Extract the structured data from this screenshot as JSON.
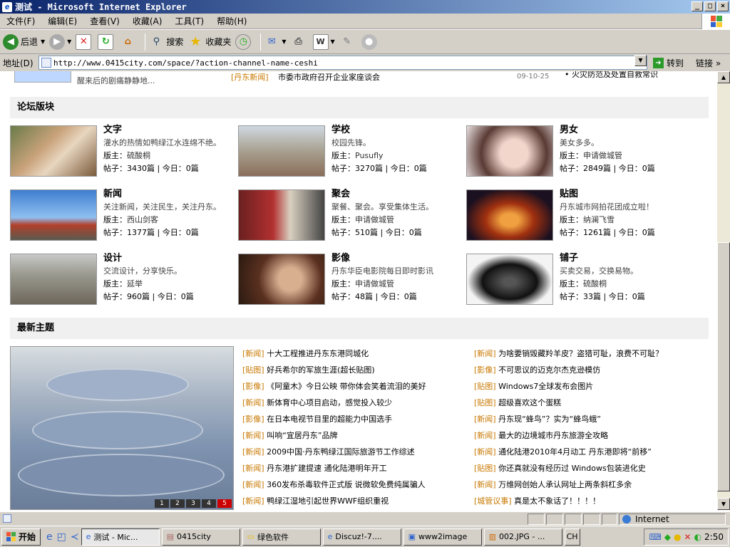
{
  "window": {
    "title": "测试 - Microsoft Internet Explorer",
    "buttons": [
      "_",
      "□",
      "×"
    ]
  },
  "menu": [
    "文件(F)",
    "编辑(E)",
    "查看(V)",
    "收藏(A)",
    "工具(T)",
    "帮助(H)"
  ],
  "toolbar": {
    "back": "后退",
    "search": "搜索",
    "favorites": "收藏夹"
  },
  "address": {
    "label": "地址(D)",
    "url": "http://www.0415city.com/space/?action-channel-name-ceshi",
    "go": "转到",
    "links": "链接"
  },
  "top_partial": {
    "left_text": "醒来后的剧痛静静地...",
    "tag": "[丹东新闻]",
    "title": "市委市政府召开企业家座谈会",
    "date": "09-10-25",
    "right_text": "• 火灾防范及处置自救常识"
  },
  "forums_section": {
    "title": "论坛版块"
  },
  "forums": [
    {
      "name": "文字",
      "desc": "灌水的热情如鸭绿江水连绵不绝。",
      "mod_label": "版主：",
      "mod": "硫酸桐",
      "stats": "帖子：3430篇 | 今日：0篇"
    },
    {
      "name": "学校",
      "desc": "校园先锋。",
      "mod_label": "版主：",
      "mod": "Pusufly",
      "stats": "帖子：3270篇 | 今日：0篇"
    },
    {
      "name": "男女",
      "desc": "美女多多。",
      "mod_label": "版主：",
      "mod": "申请做城管",
      "stats": "帖子：2849篇 | 今日：0篇"
    },
    {
      "name": "新闻",
      "desc": "关注新闻，关注民生，关注丹东。",
      "mod_label": "版主：",
      "mod": "西山剑客",
      "stats": "帖子：1377篇 | 今日：0篇"
    },
    {
      "name": "聚会",
      "desc": "聚餐、聚会。享受集体生活。",
      "mod_label": "版主：",
      "mod": "申请做城管",
      "stats": "帖子：510篇 | 今日：0篇"
    },
    {
      "name": "贴图",
      "desc": "丹东城市网拍花团成立啦！",
      "mod_label": "版主：",
      "mod": "纳澜飞雪",
      "stats": "帖子：1261篇 | 今日：0篇"
    },
    {
      "name": "设计",
      "desc": "交流设计，分享快乐。",
      "mod_label": "版主：",
      "mod": "延举",
      "stats": "帖子：960篇 | 今日：0篇"
    },
    {
      "name": "影像",
      "desc": "丹东华臣电影院每日即时影讯",
      "mod_label": "版主：",
      "mod": "申请做城管",
      "stats": "帖子：48篇 | 今日：0篇"
    },
    {
      "name": "铺子",
      "desc": "买卖交易，交换易物。",
      "mod_label": "版主：",
      "mod": "硫酸桐",
      "stats": "帖子：33篇 | 今日：0篇"
    }
  ],
  "latest_section": {
    "title": "最新主题"
  },
  "slide_pager": [
    "1",
    "2",
    "3",
    "4",
    "5"
  ],
  "topics_left": [
    {
      "tag": "[新闻]",
      "title": "十大工程推进丹东东港同城化"
    },
    {
      "tag": "[贴图]",
      "title": "好兵希尔的军旅生涯(超长贴图)"
    },
    {
      "tag": "[影像]",
      "title": "《阿童木》今日公映 带你体会笑着流泪的美好"
    },
    {
      "tag": "[新闻]",
      "title": "新体育中心项目启动，感觉投入较少"
    },
    {
      "tag": "[影像]",
      "title": "在日本电视节目里的超能力中国选手"
    },
    {
      "tag": "[新闻]",
      "title": "叫响“宜居丹东”品牌"
    },
    {
      "tag": "[新闻]",
      "title": "2009中国·丹东鸭绿江国际旅游节工作综述"
    },
    {
      "tag": "[新闻]",
      "title": "丹东港扩建提速 通化陆港明年开工"
    },
    {
      "tag": "[新闻]",
      "title": "360发布杀毒软件正式版 说微软免费纯属骗人"
    },
    {
      "tag": "[新闻]",
      "title": "鸭绿江湿地引起世界WWF组织重视"
    }
  ],
  "topics_right": [
    {
      "tag": "[新闻]",
      "title": "为啥要销毁藏羚羊皮？盗猎可耻，浪费不可耻？"
    },
    {
      "tag": "[影像]",
      "title": "不可思议的迈克尔杰克逊模仿"
    },
    {
      "tag": "[贴图]",
      "title": "Windows7全球发布会图片"
    },
    {
      "tag": "[贴图]",
      "title": "超级喜欢这个蛋糕"
    },
    {
      "tag": "[新闻]",
      "title": "丹东现“蜂鸟”？实为“蜂鸟蛾”"
    },
    {
      "tag": "[新闻]",
      "title": "最大的边境城市丹东旅游全攻略"
    },
    {
      "tag": "[新闻]",
      "title": "通化陆港2010年4月动工 丹东港即将“前移”"
    },
    {
      "tag": "[贴图]",
      "title": "你还真就没有经历过 Windows包装进化史"
    },
    {
      "tag": "[新闻]",
      "title": "万维网创始人承认网址上两条斜杠多余"
    },
    {
      "tag": "[城管议事]",
      "title": "真是太不象话了！！！！"
    }
  ],
  "status": {
    "zone": "Internet"
  },
  "taskbar": {
    "start": "开始",
    "tasks": [
      "测试 - Mic...",
      "0415city",
      "绿色软件",
      "Discuz!-7....",
      "www2image",
      "002.JPG - ..."
    ],
    "lang": "CH",
    "clock": "2:50"
  },
  "colors": {
    "title_start": "#0a246a",
    "title_end": "#a6caf0",
    "tag": "#c87800",
    "chrome": "#d4d0c8"
  }
}
